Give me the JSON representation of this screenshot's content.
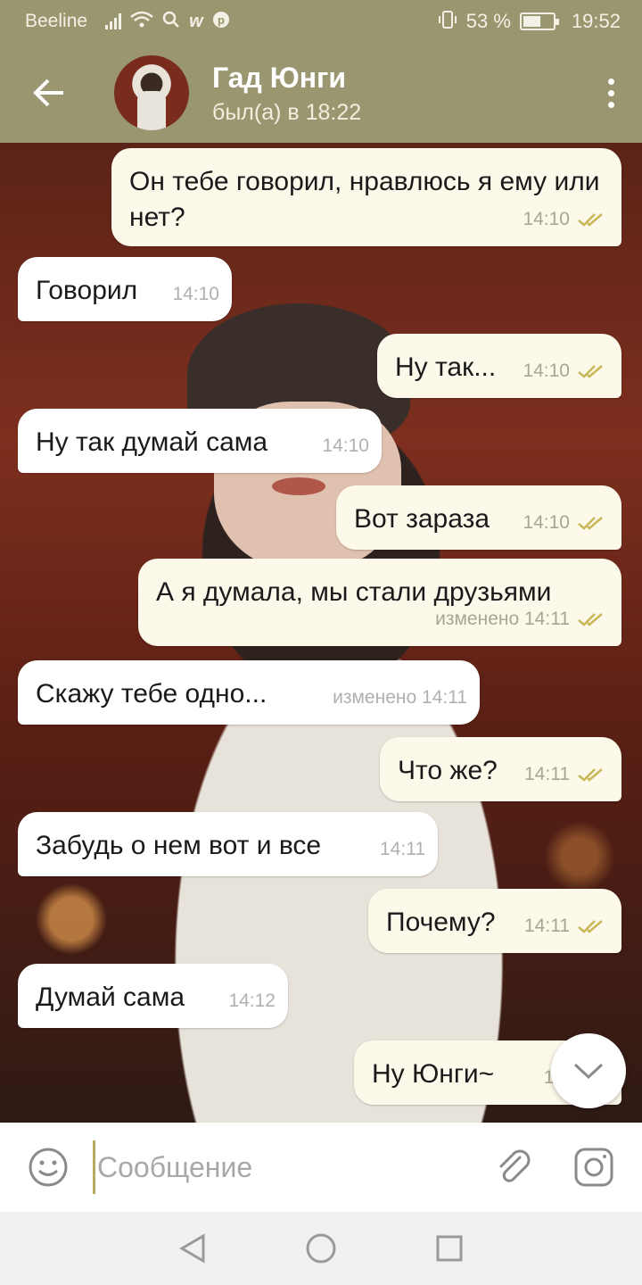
{
  "status_bar": {
    "carrier": "Beeline",
    "battery": "53 %",
    "battery_level": 0.53,
    "time": "19:52",
    "icons": [
      "signal-icon",
      "wifi-icon",
      "search-icon",
      "w-icon",
      "pinterest-icon",
      "vibrate-icon",
      "battery-icon"
    ]
  },
  "header": {
    "title": "Гад Юнги",
    "status": "был(а) в 18:22"
  },
  "messages": [
    {
      "dir": "out",
      "text": "Он тебе говорил, нравлюсь я ему или нет?",
      "time": "14:10",
      "read": true
    },
    {
      "dir": "in",
      "text": "Говорил",
      "time": "14:10"
    },
    {
      "dir": "out",
      "text": "Ну так...",
      "time": "14:10",
      "read": true
    },
    {
      "dir": "in",
      "text": "Ну так думай сама",
      "time": "14:10"
    },
    {
      "dir": "out",
      "text": "Вот зараза",
      "time": "14:10",
      "read": true
    },
    {
      "dir": "out",
      "text": "А я думала, мы стали друзьями",
      "time": "изменено 14:11",
      "read": true
    },
    {
      "dir": "in",
      "text": "Скажу тебе одно...",
      "time": "изменено 14:11"
    },
    {
      "dir": "out",
      "text": "Что же?",
      "time": "14:11",
      "read": true
    },
    {
      "dir": "in",
      "text": "Забудь о нем вот и все",
      "time": "14:11"
    },
    {
      "dir": "out",
      "text": "Почему?",
      "time": "14:11",
      "read": true
    },
    {
      "dir": "in",
      "text": "Думай сама",
      "time": "14:12"
    },
    {
      "dir": "out",
      "text": "Ну Юнги~",
      "time": "14:",
      "read": true
    }
  ],
  "input": {
    "placeholder": "Сообщение"
  },
  "colors": {
    "header": "#9a9670",
    "outgoing_bubble": "#fcf9ea",
    "incoming_bubble": "#ffffff",
    "check_color": "#c9b85a"
  }
}
